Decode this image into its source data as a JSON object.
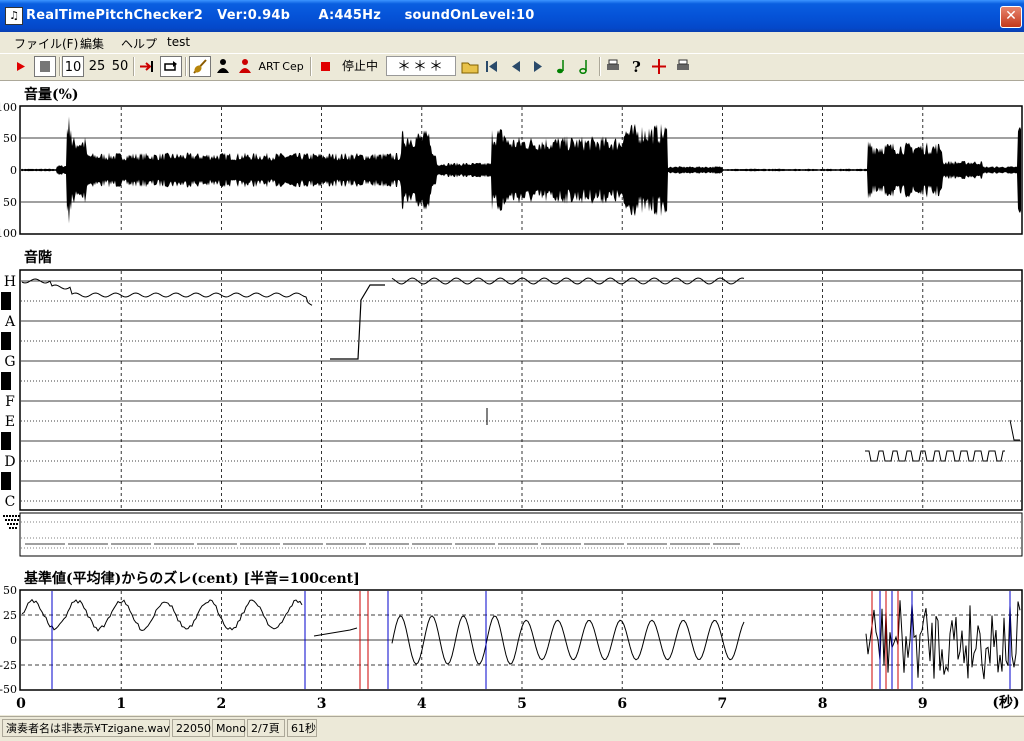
{
  "window": {
    "title": "RealTimePitchChecker2   Ver:0.94b      A:445Hz     soundOnLevel:10",
    "icon": "music-note-icon",
    "close": "✕"
  },
  "menu": [
    "ファイル(F)",
    "編集",
    "ヘルプ",
    "test"
  ],
  "toolbar": {
    "speed_10": "10",
    "speed_25": "25",
    "speed_50": "50",
    "art_label": "ART",
    "cep_label": "Cep",
    "stop_status": "停止中",
    "note_display": "＊＊＊"
  },
  "panels": {
    "volume_title": "音量(%)",
    "volume_ticks": [
      "100",
      "50",
      "0",
      "50",
      "100"
    ],
    "pitch_title": "音階",
    "pitch_notes": [
      "H",
      "A",
      "G",
      "F",
      "E",
      "D",
      "C"
    ],
    "cent_title": "基準値(平均律)からのズレ(cent) [半音=100cent]",
    "cent_ticks": [
      "50",
      "25",
      "0",
      "-25",
      "-50"
    ],
    "time_ticks": [
      "0",
      "1",
      "2",
      "3",
      "4",
      "5",
      "6",
      "7",
      "8",
      "9"
    ],
    "time_unit": "(秒)"
  },
  "statusbar": {
    "file": "演奏者名は非表示¥Tzigane.wav",
    "rate": "22050",
    "channels": "Mono",
    "page": "2/7頁",
    "duration": "61秒"
  }
}
